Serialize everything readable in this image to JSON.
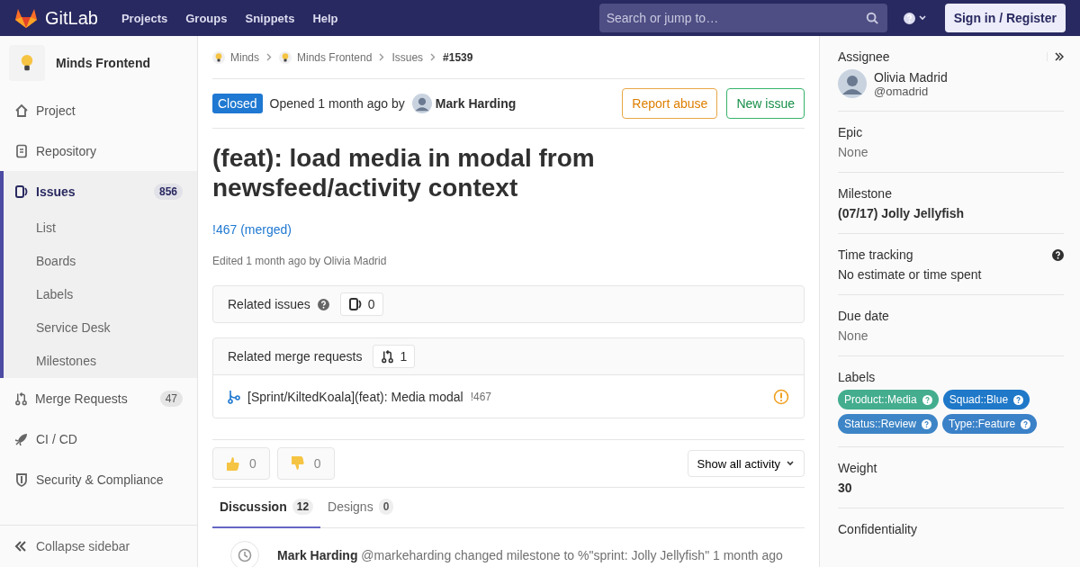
{
  "topbar": {
    "brand": "GitLab",
    "nav": [
      "Projects",
      "Groups",
      "Snippets",
      "Help"
    ],
    "search": {
      "placeholder": "Search or jump to…"
    },
    "sign_in": "Sign in / Register"
  },
  "sidebar": {
    "project": "Minds Frontend",
    "items": [
      {
        "label": "Project",
        "selected": false
      },
      {
        "label": "Repository",
        "selected": false
      },
      {
        "label": "Issues",
        "selected": true,
        "count": "856",
        "children": [
          {
            "label": "List"
          },
          {
            "label": "Boards"
          },
          {
            "label": "Labels"
          },
          {
            "label": "Service Desk"
          },
          {
            "label": "Milestones"
          }
        ]
      },
      {
        "label": "Merge Requests",
        "selected": false,
        "count": "47"
      },
      {
        "label": "CI / CD",
        "selected": false
      },
      {
        "label": "Security & Compliance",
        "selected": false
      }
    ],
    "collapse": "Collapse sidebar"
  },
  "breadcrumbs": [
    "Minds",
    "Minds Frontend",
    "Issues",
    "#1539"
  ],
  "issue": {
    "status": "Closed",
    "opened": "Opened 1 month ago by",
    "author": "Mark Harding",
    "buttons": [
      "Report abuse",
      "New issue"
    ],
    "title": "(feat): load media in modal from newsfeed/activity context",
    "mr_link": "!467 (merged)",
    "edited": "Edited 1 month ago by Olivia Madrid"
  },
  "related_issues": {
    "title": "Related issues",
    "count": "0"
  },
  "related_merge_requests": {
    "title": "Related merge requests",
    "count": "1",
    "items": [
      {
        "title": "[Sprint/KiltedKoala](feat): Media modal",
        "ref": "!467"
      }
    ]
  },
  "awards": [
    {
      "count": "0"
    },
    {
      "count": "0"
    }
  ],
  "activity_filter": "Show all activity",
  "tabs": [
    {
      "label": "Discussion",
      "count": "12",
      "selected": true
    },
    {
      "label": "Designs",
      "count": "0",
      "selected": false
    }
  ],
  "notes": [
    {
      "author": "Mark Harding",
      "text": "@markeharding changed milestone to %\"sprint: Jolly Jellyfish\" 1 month ago"
    }
  ],
  "right_sidebar": {
    "assignee": {
      "label": "Assignee",
      "name": "Olivia Madrid",
      "username": "@omadrid"
    },
    "sections": [
      {
        "label": "Epic",
        "value": "None",
        "kind": "muted"
      },
      {
        "label": "Milestone",
        "value": "(07/17) Jolly Jellyfish",
        "kind": "bold"
      },
      {
        "label": "Time tracking",
        "value": "No estimate or time spent",
        "kind": "help"
      },
      {
        "label": "Due date",
        "value": "None",
        "kind": "muted"
      }
    ],
    "labels": {
      "label": "Labels",
      "items": [
        {
          "name": "Product::Media",
          "color": "#44ad8e"
        },
        {
          "name": "Squad::Blue",
          "color": "#1f78c8"
        },
        {
          "name": "Status::Review",
          "color": "#3d85c6"
        },
        {
          "name": "Type::Feature",
          "color": "#3a81c8"
        }
      ]
    },
    "weight": {
      "label": "Weight",
      "value": "30"
    },
    "confidentiality": {
      "label": "Confidentiality"
    }
  }
}
